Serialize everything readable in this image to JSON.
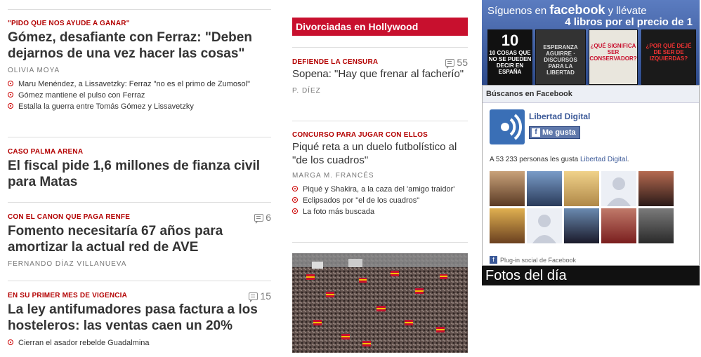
{
  "col1": {
    "stories": [
      {
        "kicker": "\"PIDO QUE NOS AYUDE A GANAR\"",
        "headline": "Gómez, desafiante con Ferraz: \"Deben dejarnos de una vez hacer las cosas\"",
        "byline": "OLIVIA MOYA",
        "related": [
          "Maru Menéndez, a Lissavetzky: Ferraz \"no es el primo de Zumosol\"",
          "Gómez mantiene el pulso con Ferraz",
          "Estalla la guerra entre Tomás Gómez y Lissavetzky"
        ]
      },
      {
        "kicker": "CASO PALMA ARENA",
        "headline": "El fiscal pide 1,6 millones de fianza civil para Matas"
      },
      {
        "kicker": "CON EL CANON QUE PAGA RENFE",
        "comments": "6",
        "headline": "Fomento necesitaría 67 años para amortizar la actual red de AVE",
        "byline": "FERNANDO DÍAZ VILLANUEVA"
      },
      {
        "kicker": "EN SU PRIMER MES DE VIGENCIA",
        "comments": "15",
        "headline": "La ley antifumadores pasa factura a los hosteleros: las ventas caen un 20%",
        "related": [
          "Cierran el asador rebelde Guadalmina"
        ]
      }
    ]
  },
  "col2": {
    "section_title": "Divorciadas en Hollywood",
    "stories": [
      {
        "kicker": "DEFIENDE LA CENSURA",
        "comments": "55",
        "headline": "Sopena: \"Hay que frenar al facherío\"",
        "byline": "P. DÍEZ"
      },
      {
        "kicker": "CONCURSO PARA JUGAR CON ELLOS",
        "headline": "Piqué reta a un duelo futbolístico al \"de los cuadros\"",
        "byline": "MARGA M. FRANCÉS",
        "related": [
          "Piqué y Shakira, a la caza del 'amigo traidor'",
          "Eclipsados por \"el de los cuadros\"",
          "La foto más buscada"
        ]
      }
    ]
  },
  "col3": {
    "banner": {
      "line1_prefix": "Síguenos en",
      "line1_brand": "facebook",
      "line1_suffix": "y llévate",
      "line2": "4 libros por el precio de 1",
      "books": [
        "10 COSAS QUE NO SE PUEDEN DECIR EN ESPAÑA",
        "ESPERANZA AGUIRRE · DISCURSOS PARA LA LIBERTAD",
        "¿QUÉ SIGNIFICA SER CONSERVADOR?",
        "¿POR QUÉ DEJÉ DE SER DE IZQUIERDAS?"
      ]
    },
    "fb": {
      "header": "Búscanos en Facebook",
      "page_name": "Libertad Digital",
      "like_label": "Me gusta",
      "count_prefix": "A 53 233 personas les gusta",
      "count_link": "Libertad Digital",
      "count_suffix": ".",
      "plugin_label": "Plug-in social de Facebook"
    },
    "fotos_label": "Fotos del día"
  }
}
